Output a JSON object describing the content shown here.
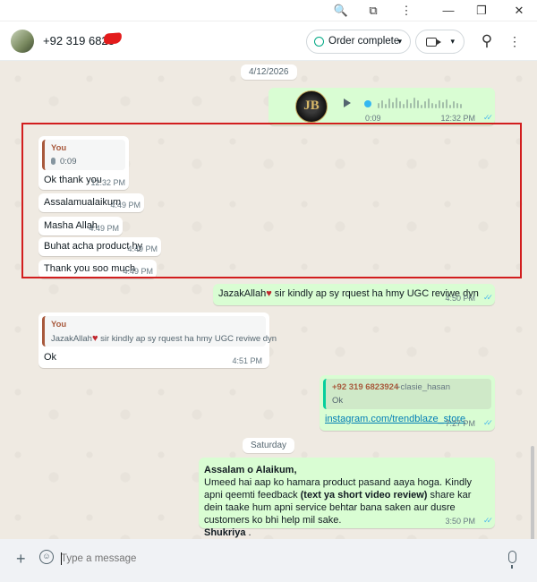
{
  "window": {
    "icons": [
      "zoom-icon",
      "extension-icon",
      "more-vert-icon",
      "minimize-icon",
      "restore-icon",
      "close-icon"
    ],
    "glyphs": {
      "zoom": "🔍",
      "ext": "⧉",
      "more": "⋮",
      "min": "—",
      "restore": "❐",
      "close": "✕"
    }
  },
  "header": {
    "contact": "+92 319 6823",
    "order_label": "Order complete",
    "chevron": "▾",
    "search_glyph": "⚲",
    "more_glyph": "⋮"
  },
  "chat": {
    "date_first": "4/12/2026",
    "voice_out": {
      "avatar_text": "JB",
      "duration": "0:09",
      "time": "12:32 PM"
    },
    "reply_block": {
      "quote_who": "You",
      "quote_text": "0:09",
      "msgs": [
        {
          "text": "Ok thank you",
          "time": "12:32 PM"
        },
        {
          "text": "Assalamualaikum",
          "time": "4:49 PM"
        },
        {
          "text": "Masha Allah",
          "time": "4:49 PM"
        },
        {
          "text": "Buhat acha product hy",
          "time": "4:49 PM"
        },
        {
          "text": "Thank you soo much",
          "time": "4:49 PM"
        }
      ]
    },
    "out_ugc": {
      "before": "JazakAllah",
      "heart": "♥",
      "after": " sir kindly ap sy rquest ha hmy UGC reviwe dyn",
      "time": "4:50 PM"
    },
    "in_ok": {
      "quote_who": "You",
      "quote_before": "JazakAllah",
      "quote_after": " sir kindly ap sy rquest ha hmy UGC reviwe dyn",
      "text": "Ok",
      "time": "4:51 PM"
    },
    "out_link": {
      "quote_who": "+92 319 6823924",
      "quote_alias": "~clasie_hasan",
      "quote_text": "Ok",
      "link": "instagram.com/trendblaze_store",
      "time": "7:27 PM"
    },
    "date_second": "Saturday",
    "out_long": {
      "greeting": "Assalam o Alaikum,",
      "line1": "Umeed hai aap ko hamara product pasand aaya hoga. Kindly apni qeemti feedback ",
      "bold1": "(text ya short video review)",
      "line2": " share kar dein taake hum apni service behtar bana saken aur dusre customers ko bhi help mil sake.",
      "thanks": "Shukriya",
      "end": " .",
      "time": "3:50 PM"
    },
    "ticks": "✓✓"
  },
  "composer": {
    "placeholder": "Type a message",
    "plus_glyph": "+",
    "smile_glyph": "☺"
  },
  "colors": {
    "accent": "#00a884",
    "outgoing": "#d9fdd3",
    "chat_bg": "#efeae2",
    "highlight_box": "#d21e1e",
    "link": "#027eb5"
  }
}
